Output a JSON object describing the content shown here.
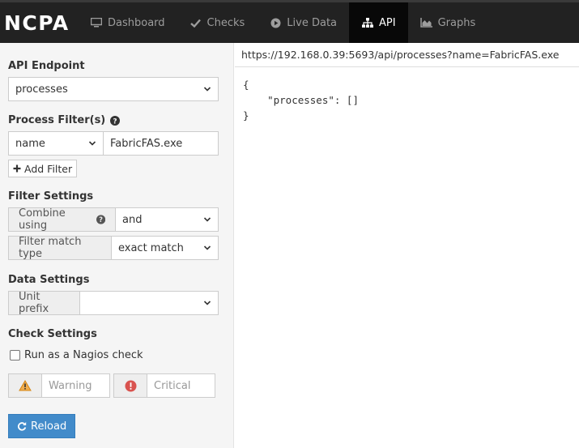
{
  "brand": "NCPA",
  "nav": {
    "dashboard": "Dashboard",
    "checks": "Checks",
    "live_data": "Live Data",
    "api": "API",
    "graphs": "Graphs"
  },
  "sidebar": {
    "endpoint_title": "API Endpoint",
    "endpoint_value": "processes",
    "filters_title": "Process Filter(s)",
    "filter_field": "name",
    "filter_value": "FabricFAS.exe",
    "add_filter": "Add Filter",
    "filter_settings_title": "Filter Settings",
    "combine_label": "Combine using",
    "combine_value": "and",
    "match_label": "Filter match type",
    "match_value": "exact match",
    "data_settings_title": "Data Settings",
    "unit_prefix_label": "Unit prefix",
    "unit_prefix_value": "",
    "check_settings_title": "Check Settings",
    "nagios_check_label": "Run as a Nagios check",
    "warning_placeholder": "Warning",
    "critical_placeholder": "Critical",
    "reload": "Reload"
  },
  "content": {
    "url": "https://192.168.0.39:5693/api/processes?name=FabricFAS.exe",
    "json_output": "{\n    \"processes\": []\n}"
  },
  "colors": {
    "navbar": "#222222",
    "nav_active": "#080808",
    "primary": "#428bca",
    "warning": "#f0ad4e",
    "danger": "#d9534f"
  }
}
